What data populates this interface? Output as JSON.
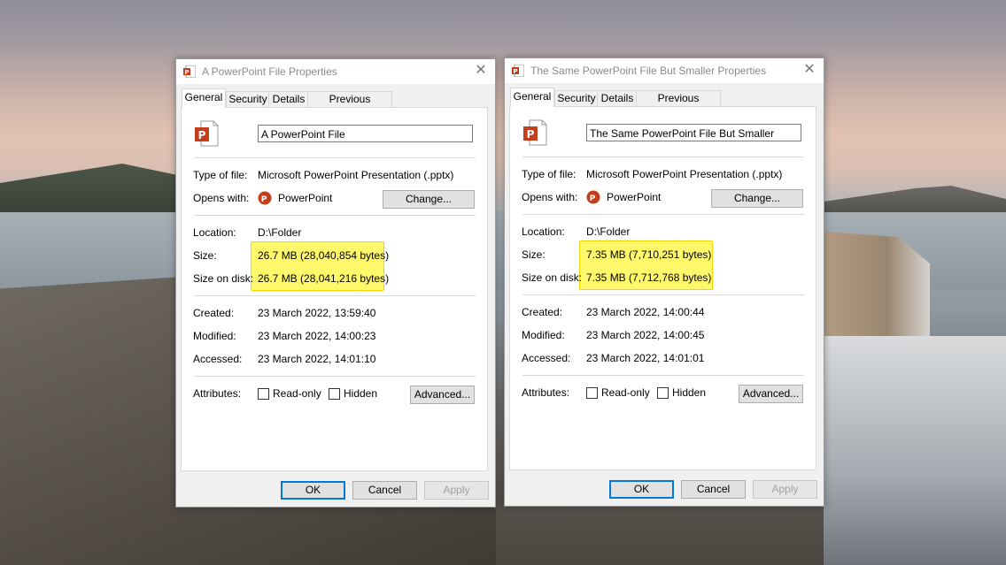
{
  "icons": {
    "file": "powerpoint-file-icon",
    "app": "powerpoint-app-icon",
    "close": "close-icon"
  },
  "colors": {
    "highlight": "#fff86b",
    "ppt_red": "#c43e1c"
  },
  "dialogs": [
    {
      "title": "A PowerPoint File Properties",
      "tabs": [
        "General",
        "Security",
        "Details",
        "Previous Versions"
      ],
      "file_name": "A PowerPoint File",
      "type_label": "Type of file:",
      "type_value": "Microsoft PowerPoint Presentation (.pptx)",
      "opens_label": "Opens with:",
      "opens_value": "PowerPoint",
      "change_label": "Change...",
      "location_label": "Location:",
      "location_value": "D:\\Folder",
      "size_label": "Size:",
      "size_value": "26.7 MB (28,040,854 bytes)",
      "size_on_disk_label": "Size on disk:",
      "size_on_disk_value": "26.7 MB (28,041,216 bytes)",
      "created_label": "Created:",
      "created_value": "23 March 2022, 13:59:40",
      "modified_label": "Modified:",
      "modified_value": "23 March 2022, 14:00:23",
      "accessed_label": "Accessed:",
      "accessed_value": "23 March 2022, 14:01:10",
      "attributes_label": "Attributes:",
      "readonly_label": "Read-only",
      "hidden_label": "Hidden",
      "advanced_label": "Advanced...",
      "ok_label": "OK",
      "cancel_label": "Cancel",
      "apply_label": "Apply"
    },
    {
      "title": "The Same PowerPoint File But Smaller Properties",
      "tabs": [
        "General",
        "Security",
        "Details",
        "Previous Versions"
      ],
      "file_name": "The Same PowerPoint File But Smaller",
      "type_label": "Type of file:",
      "type_value": "Microsoft PowerPoint Presentation (.pptx)",
      "opens_label": "Opens with:",
      "opens_value": "PowerPoint",
      "change_label": "Change...",
      "location_label": "Location:",
      "location_value": "D:\\Folder",
      "size_label": "Size:",
      "size_value": "7.35 MB (7,710,251 bytes)",
      "size_on_disk_label": "Size on disk:",
      "size_on_disk_value": "7.35 MB (7,712,768 bytes)",
      "created_label": "Created:",
      "created_value": "23 March 2022, 14:00:44",
      "modified_label": "Modified:",
      "modified_value": "23 March 2022, 14:00:45",
      "accessed_label": "Accessed:",
      "accessed_value": "23 March 2022, 14:01:01",
      "attributes_label": "Attributes:",
      "readonly_label": "Read-only",
      "hidden_label": "Hidden",
      "advanced_label": "Advanced...",
      "ok_label": "OK",
      "cancel_label": "Cancel",
      "apply_label": "Apply"
    }
  ]
}
